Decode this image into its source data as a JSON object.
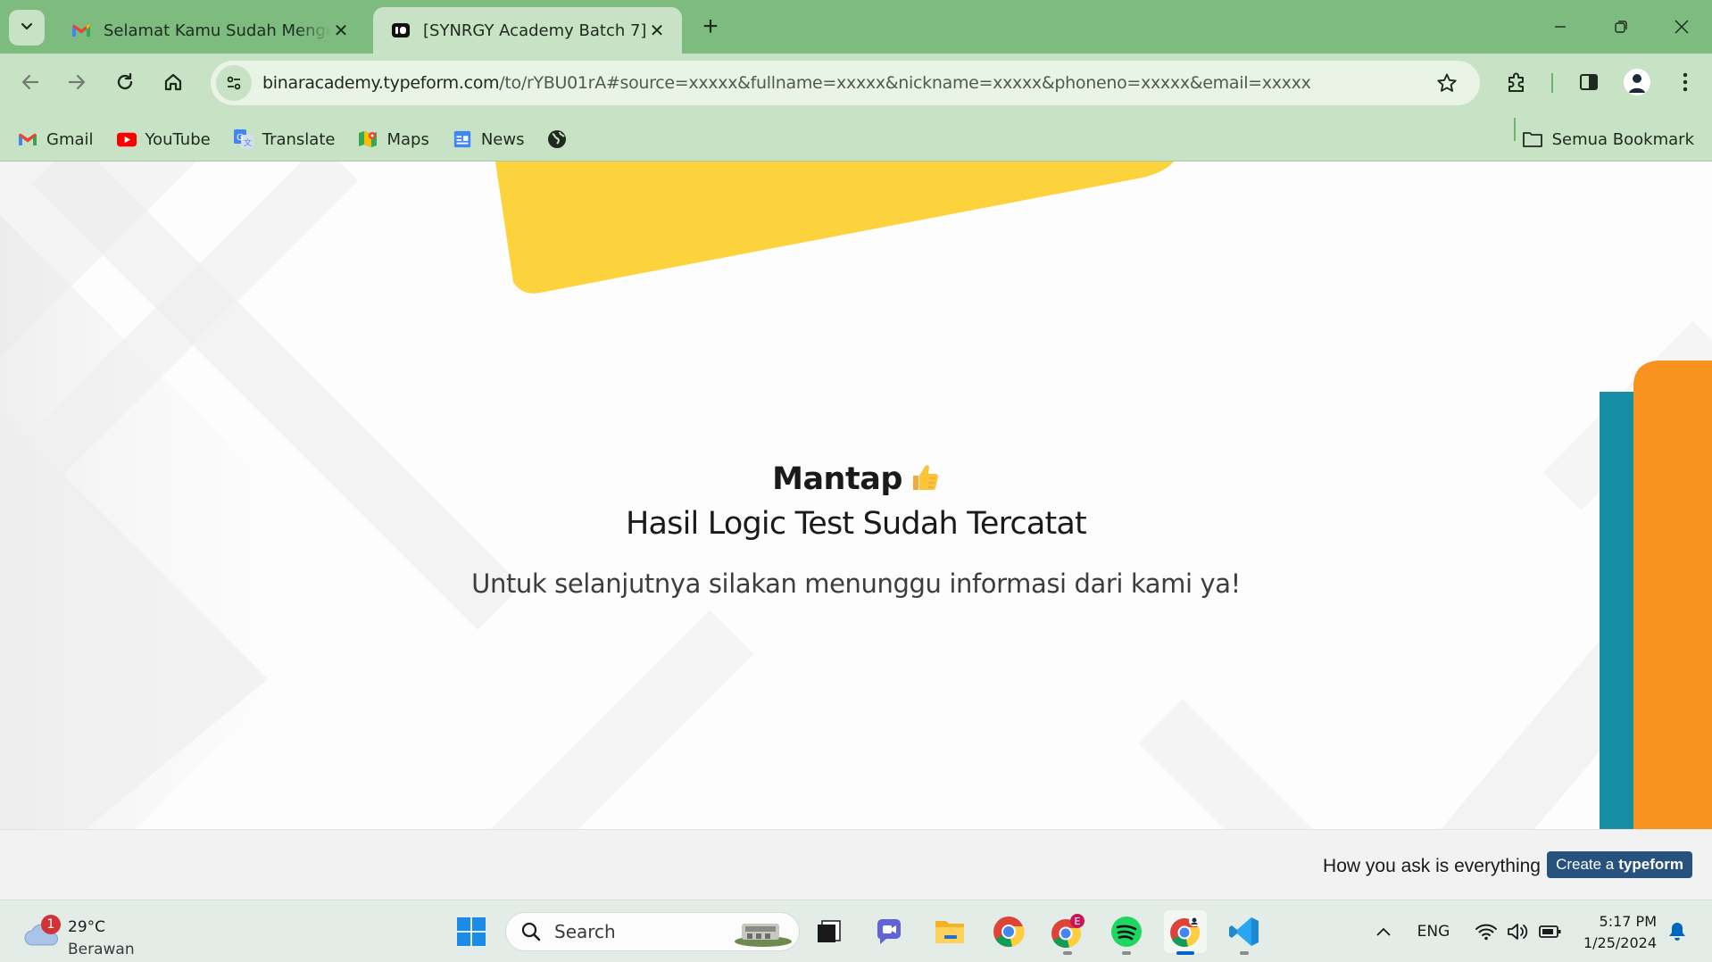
{
  "browser": {
    "tabs": [
      {
        "title": "Selamat Kamu Sudah Mengerjakan",
        "active": false
      },
      {
        "title": "[SYNRGY Academy Batch 7]",
        "active": true
      }
    ],
    "url_host": "binaracademy.typeform.com",
    "url_path": "/to/rYBU01rA#source=xxxxx&fullname=xxxxx&nickname=xxxxx&phoneno=xxxxx&email=xxxxx",
    "bookmarks": [
      {
        "label": "Gmail",
        "icon": "gmail-icon"
      },
      {
        "label": "YouTube",
        "icon": "youtube-icon"
      },
      {
        "label": "Translate",
        "icon": "translate-icon"
      },
      {
        "label": "Maps",
        "icon": "maps-icon"
      },
      {
        "label": "News",
        "icon": "news-icon"
      },
      {
        "label": "",
        "icon": "globe-icon"
      }
    ],
    "all_bookmarks": "Semua Bookmark"
  },
  "page": {
    "heading": "Mantap",
    "heading_emoji": "thumbs-up-icon",
    "subheading": "Hasil Logic Test Sudah Tercatat",
    "message": "Untuk selanjutnya silakan menunggu informasi dari kami ya!",
    "footer_tagline": "How you ask is everything",
    "footer_cta_prefix": "Create a",
    "footer_cta_brand": "typeform",
    "colors": {
      "yellow_shape": "#fdd33d",
      "teal_shape": "#188ea4",
      "orange_shape": "#f7931e",
      "cta": "#27527d"
    }
  },
  "taskbar": {
    "weather": {
      "temp": "29°C",
      "condition": "Berawan",
      "badge": "1"
    },
    "search_placeholder": "Search",
    "apps": [
      "file-manager-icon",
      "teams-chat-icon",
      "file-explorer-icon",
      "chrome-icon",
      "chrome-profile-e-icon",
      "spotify-icon",
      "chrome-profile-active-icon",
      "vscode-icon"
    ],
    "language": "ENG",
    "time": "5:17 PM",
    "date": "1/25/2024"
  }
}
